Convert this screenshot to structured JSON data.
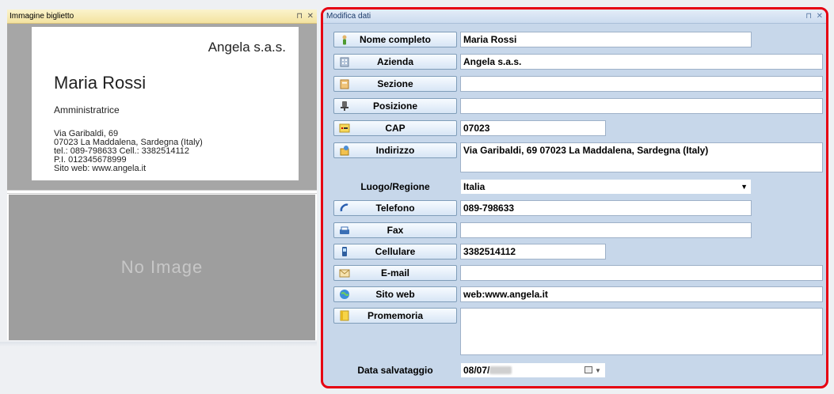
{
  "left_panel": {
    "title": "Immagine biglietto",
    "pin": "⊓",
    "close": "✕",
    "card": {
      "company": "Angela s.a.s.",
      "name": "Maria Rossi",
      "role": "Amministratrice",
      "address_line1": "Via Garibaldi, 69",
      "address_line2": "07023 La Maddalena, Sardegna (Italy)",
      "phone_line": "tel.: 089-798633   Cell.: 3382514112",
      "vat_line": "P.I. 012345678999",
      "web_line": "Sito web: www.angela.it"
    },
    "no_image": "No Image"
  },
  "right_panel": {
    "title": "Modifica dati",
    "pin": "⊓",
    "close": "✕",
    "fields": {
      "nome": {
        "label": "Nome completo",
        "value": "Maria Rossi",
        "icon": "person-icon"
      },
      "azienda": {
        "label": "Azienda",
        "value": "Angela s.a.s.",
        "icon": "building-icon"
      },
      "sezione": {
        "label": "Sezione",
        "value": "",
        "icon": "folder-icon"
      },
      "posizione": {
        "label": "Posizione",
        "value": "",
        "icon": "chair-icon"
      },
      "cap": {
        "label": "CAP",
        "value": "07023",
        "icon": "postal-code-icon"
      },
      "indirizzo": {
        "label": "Indirizzo",
        "value": "Via Garibaldi, 69 07023 La Maddalena, Sardegna (Italy)",
        "icon": "address-icon"
      },
      "luogo": {
        "label": "Luogo/Regione",
        "value": "Italia"
      },
      "telefono": {
        "label": "Telefono",
        "value": "089-798633",
        "icon": "phone-icon"
      },
      "fax": {
        "label": "Fax",
        "value": "",
        "icon": "fax-icon"
      },
      "cellulare": {
        "label": "Cellulare",
        "value": "3382514112",
        "icon": "mobile-icon"
      },
      "email": {
        "label": "E-mail",
        "value": "",
        "icon": "envelope-icon"
      },
      "sito": {
        "label": "Sito web",
        "value": "web:www.angela.it",
        "icon": "globe-icon"
      },
      "promemoria": {
        "label": "Promemoria",
        "value": "",
        "icon": "note-icon"
      },
      "data": {
        "label": "Data salvataggio",
        "value": "08/07/"
      }
    }
  },
  "colors": {
    "highlight_border": "#e60012",
    "panel_bg": "#c7d7ea",
    "left_header": "#f3e2a0"
  }
}
